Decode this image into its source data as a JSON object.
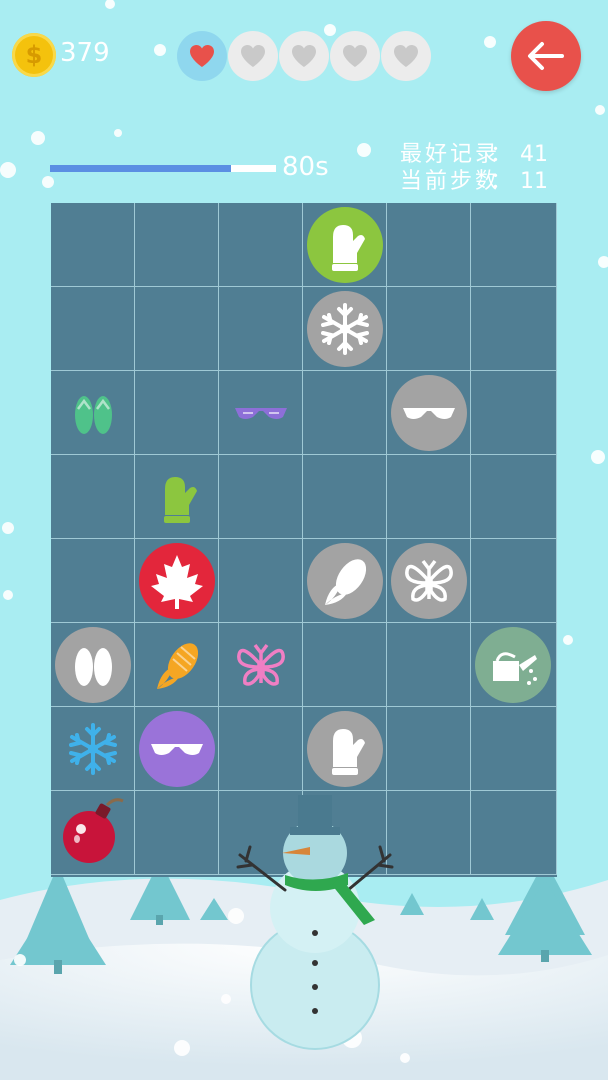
{
  "hud": {
    "coins": "379",
    "coin_symbol": "$",
    "lives": [
      {
        "state": "full",
        "color": "#e8514b"
      },
      {
        "state": "empty",
        "color": "#c9c9c9"
      },
      {
        "state": "empty",
        "color": "#c9c9c9"
      },
      {
        "state": "empty",
        "color": "#c9c9c9"
      },
      {
        "state": "empty",
        "color": "#c9c9c9"
      }
    ],
    "back_icon": "arrow-left-icon",
    "timer": {
      "label": "80s",
      "progress": 0.8
    }
  },
  "stats": {
    "best": {
      "label": "最好记录",
      "separator": "：",
      "value": "41"
    },
    "current": {
      "label": "当前步数",
      "separator": "：",
      "value": "11"
    }
  },
  "board": {
    "cols": 6,
    "rows": 8,
    "tiles": [
      {
        "row": 0,
        "col": 3,
        "icon": "mitten-icon",
        "bg": "#8cc63f",
        "fg": "#ffffff"
      },
      {
        "row": 1,
        "col": 3,
        "icon": "snowflake-icon",
        "bg": "#a3a3a3",
        "fg": "#ffffff"
      },
      {
        "row": 2,
        "col": 0,
        "icon": "flip-flops-icon",
        "bg": "",
        "fg": "#4fc28a"
      },
      {
        "row": 2,
        "col": 2,
        "icon": "sunglasses-icon",
        "bg": "",
        "fg": "#8d6fd8"
      },
      {
        "row": 2,
        "col": 4,
        "icon": "sunglasses-icon",
        "bg": "#a3a3a3",
        "fg": "#ffffff"
      },
      {
        "row": 3,
        "col": 1,
        "icon": "mitten-icon",
        "bg": "",
        "fg": "#8cc63f"
      },
      {
        "row": 4,
        "col": 1,
        "icon": "maple-leaf-icon",
        "bg": "#e3263b",
        "fg": "#ffffff"
      },
      {
        "row": 4,
        "col": 3,
        "icon": "corn-icon",
        "bg": "#a3a3a3",
        "fg": "#ffffff"
      },
      {
        "row": 4,
        "col": 4,
        "icon": "butterfly-icon",
        "bg": "#a3a3a3",
        "fg": "#ffffff"
      },
      {
        "row": 5,
        "col": 0,
        "icon": "flip-flops-icon",
        "bg": "#a3a3a3",
        "fg": "#ffffff"
      },
      {
        "row": 5,
        "col": 1,
        "icon": "corn-icon",
        "bg": "",
        "fg": "#f5a623"
      },
      {
        "row": 5,
        "col": 2,
        "icon": "butterfly-icon",
        "bg": "",
        "fg": "#f07fc4"
      },
      {
        "row": 5,
        "col": 5,
        "icon": "watering-can-icon",
        "bg": "#7fae92",
        "fg": "#ffffff"
      },
      {
        "row": 6,
        "col": 0,
        "icon": "snowflake-icon",
        "bg": "",
        "fg": "#3fb1ea"
      },
      {
        "row": 6,
        "col": 1,
        "icon": "sunglasses-icon",
        "bg": "#9a73d9",
        "fg": "#ffffff"
      },
      {
        "row": 6,
        "col": 3,
        "icon": "mitten-icon",
        "bg": "#a3a3a3",
        "fg": "#ffffff"
      },
      {
        "row": 7,
        "col": 0,
        "icon": "bomb-icon",
        "bg": "",
        "fg": "#c8143a"
      }
    ]
  },
  "scene": {
    "icons": [
      "snowman-icon",
      "pine-tree-icon",
      "snowflake-icon"
    ]
  }
}
